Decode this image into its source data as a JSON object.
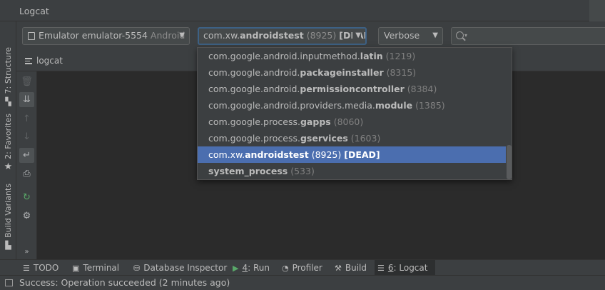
{
  "window": {
    "title": "Logcat"
  },
  "left_strip": {
    "tabs": [
      {
        "label": "7: Structure",
        "icon": "structure-icon"
      },
      {
        "label": "2: Favorites",
        "icon": "star-icon"
      },
      {
        "label": "Build Variants",
        "icon": "build-variants-icon"
      }
    ],
    "more_label": "»"
  },
  "toolbar": {
    "device": {
      "name": "Emulator emulator-5554",
      "suffix": "Android"
    },
    "process": {
      "package_prefix": "com.xw.",
      "package_bold": "androidstest",
      "pid": "(8925)",
      "status": "[DEAD]"
    },
    "log_level": "Verbose",
    "search": {
      "value": "",
      "placeholder": ""
    }
  },
  "logcat_tab": {
    "label": "logcat"
  },
  "log_tools": [
    {
      "icon": "trash-icon",
      "name": "clear-logcat-button"
    },
    {
      "icon": "scroll-to-end-icon",
      "name": "scroll-to-end-button"
    },
    {
      "icon": "up-arrow-icon",
      "name": "previous-occurrence-button"
    },
    {
      "icon": "down-arrow-icon",
      "name": "next-occurrence-button"
    },
    {
      "icon": "soft-wrap-icon",
      "name": "soft-wrap-button"
    },
    {
      "icon": "print-icon",
      "name": "print-button"
    },
    {
      "icon": "restart-icon",
      "name": "restart-button"
    },
    {
      "icon": "gear-icon",
      "name": "settings-button"
    }
  ],
  "process_dropdown": {
    "items": [
      {
        "prefix": "com.google.android.inputmethod.",
        "bold": "latin",
        "suffix": "",
        "pid": "(1219)"
      },
      {
        "prefix": "com.google.android.",
        "bold": "packageinstaller",
        "suffix": "",
        "pid": "(8315)"
      },
      {
        "prefix": "com.google.android.",
        "bold": "permissioncontroller",
        "suffix": "",
        "pid": "(8384)"
      },
      {
        "prefix": "com.google.android.providers.media.",
        "bold": "module",
        "suffix": "",
        "pid": "(1385)"
      },
      {
        "prefix": "com.google.process.",
        "bold": "gapps",
        "suffix": "",
        "pid": "(8060)"
      },
      {
        "prefix": "com.google.process.",
        "bold": "gservices",
        "suffix": "",
        "pid": "(1603)"
      },
      {
        "prefix": "com.xw.",
        "bold": "androidstest",
        "suffix": "",
        "pid": "(8925)",
        "status": "[DEAD]",
        "selected": true
      },
      {
        "prefix": "",
        "bold": "system_process",
        "suffix": "",
        "pid": "(533)"
      }
    ]
  },
  "bottom_tabs": [
    {
      "icon": "todo-icon",
      "label": "TODO"
    },
    {
      "icon": "terminal-icon",
      "label": "Terminal"
    },
    {
      "icon": "database-icon",
      "label": "Database Inspector"
    },
    {
      "icon": "run-icon",
      "mnemonic": "4",
      "label": ": Run"
    },
    {
      "icon": "profiler-icon",
      "label": "Profiler"
    },
    {
      "icon": "build-icon",
      "label": "Build"
    },
    {
      "icon": "logcat-icon",
      "mnemonic": "6",
      "label": ": Logcat",
      "active": true
    }
  ],
  "status_bar": {
    "message": "Success: Operation succeeded (2 minutes ago)"
  },
  "colors": {
    "selection": "#4b6eaf",
    "focus_border": "#3d6185",
    "panel": "#3c3f41",
    "editor": "#2b2b2b"
  }
}
